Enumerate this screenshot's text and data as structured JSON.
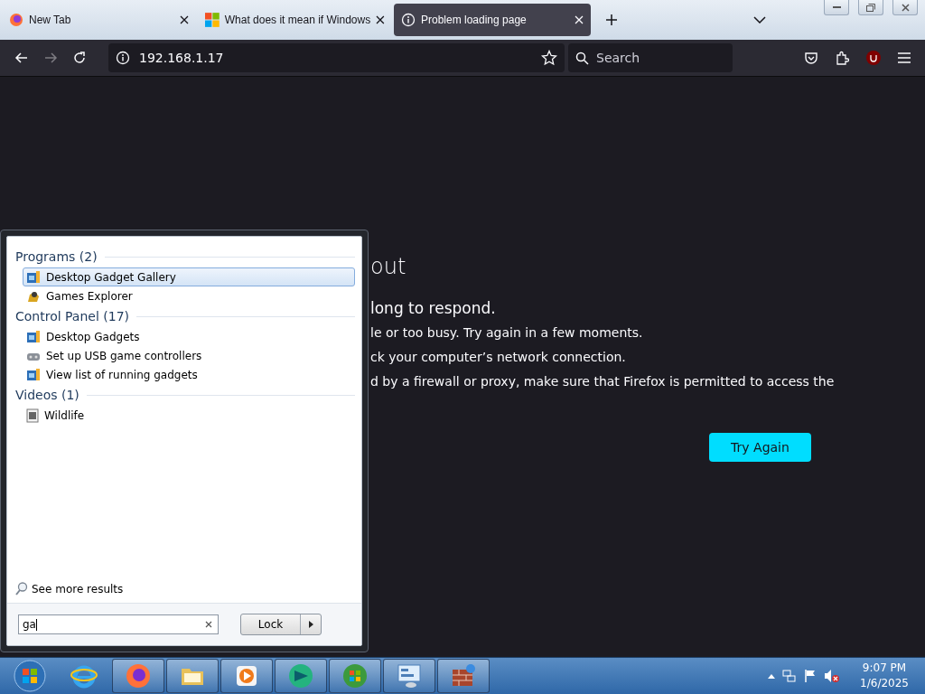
{
  "browser": {
    "tabs": [
      {
        "title": "New Tab",
        "kind": "firefox",
        "selected": false
      },
      {
        "title": "What does it mean if Windows",
        "kind": "microsoft",
        "selected": false
      },
      {
        "title": "Problem loading page",
        "kind": "info",
        "selected": true
      }
    ],
    "address": "192.168.1.17",
    "search": {
      "placeholder": "Search"
    }
  },
  "error_page": {
    "title": "out",
    "subtitle": "long to respond.",
    "lines": [
      "le or too busy. Try again in a few moments.",
      "ck your computer’s network connection.",
      "d by a firewall or proxy, make sure that Firefox is permitted to access the"
    ],
    "button": "Try Again"
  },
  "start_menu": {
    "sections": [
      {
        "heading": "Programs (2)",
        "items": [
          {
            "label": "Desktop Gadget Gallery",
            "kind": "gadget",
            "selected": true
          },
          {
            "label": "Games Explorer",
            "kind": "games",
            "selected": false
          }
        ]
      },
      {
        "heading": "Control Panel (17)",
        "items": [
          {
            "label": "Desktop Gadgets",
            "kind": "gadget",
            "selected": false
          },
          {
            "label": "Set up USB game controllers",
            "kind": "controller",
            "selected": false
          },
          {
            "label": "View list of running gadgets",
            "kind": "gadget",
            "selected": false
          }
        ]
      },
      {
        "heading": "Videos (1)",
        "items": [
          {
            "label": "Wildlife",
            "kind": "video",
            "selected": false
          }
        ]
      }
    ],
    "see_more": "See more results",
    "search": {
      "value": "ga"
    },
    "power_button": "Lock"
  },
  "taskbar": {
    "items": [
      {
        "kind": "start",
        "open": false
      },
      {
        "kind": "ie",
        "open": false
      },
      {
        "kind": "firefox",
        "open": true
      },
      {
        "kind": "folder",
        "open": true
      },
      {
        "kind": "media",
        "open": true
      },
      {
        "kind": "app",
        "open": true
      },
      {
        "kind": "windows",
        "open": true
      },
      {
        "kind": "panel",
        "open": true
      },
      {
        "kind": "firewall",
        "open": true
      }
    ],
    "clock": {
      "time": "9:07 PM",
      "date": "1/6/2025"
    }
  }
}
